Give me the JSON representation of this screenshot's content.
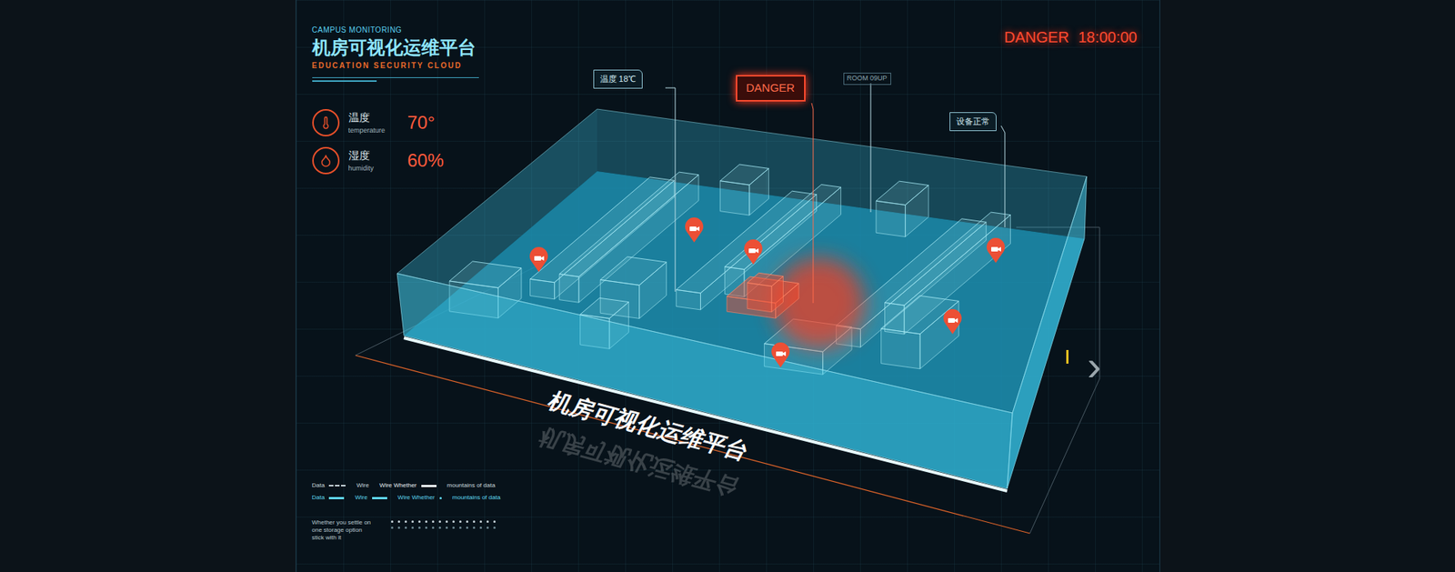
{
  "header": {
    "kicker": "CAMPUS MONITORING",
    "title": "机房可视化运维平台",
    "subtitle": "EDUCATION SECURITY CLOUD"
  },
  "alarm": {
    "label": "DANGER",
    "time": "18:00:00"
  },
  "stats": [
    {
      "label": "温度",
      "sub": "temperature",
      "value": "70°",
      "kind": "temperature"
    },
    {
      "label": "湿度",
      "sub": "humidity",
      "value": "60%",
      "kind": "humidity"
    }
  ],
  "callouts": [
    {
      "text": "温度 18℃",
      "kind": "info"
    },
    {
      "text": "DANGER",
      "kind": "alert"
    },
    {
      "text": "ROOM 09UP",
      "kind": "tag"
    },
    {
      "text": "设备正常",
      "kind": "info"
    }
  ],
  "alert_active": true,
  "floor_title": "机房可视化运维平台",
  "legend": [
    [
      {
        "label": "Data",
        "kind": "dashed",
        "color": "#c8d6dc"
      },
      {
        "label": "Wire",
        "kind": "none",
        "color": "#c8d6dc"
      },
      {
        "label": "Wire Whether",
        "kind": "bar",
        "color": "#e8f0f2"
      },
      {
        "label": "mountains of data",
        "kind": "none",
        "color": "#c8d6dc"
      }
    ],
    [
      {
        "label": "Data",
        "kind": "bar",
        "color": "#5fd6ee"
      },
      {
        "label": "Wire",
        "kind": "bar",
        "color": "#5fd6ee"
      },
      {
        "label": "Wire Whether",
        "kind": "dot",
        "color": "#5fd6ee"
      },
      {
        "label": "mountains of data",
        "kind": "none",
        "color": "#5fd6ee"
      }
    ]
  ],
  "note": "Whether you settle on one storage option stick with it",
  "next": "›"
}
